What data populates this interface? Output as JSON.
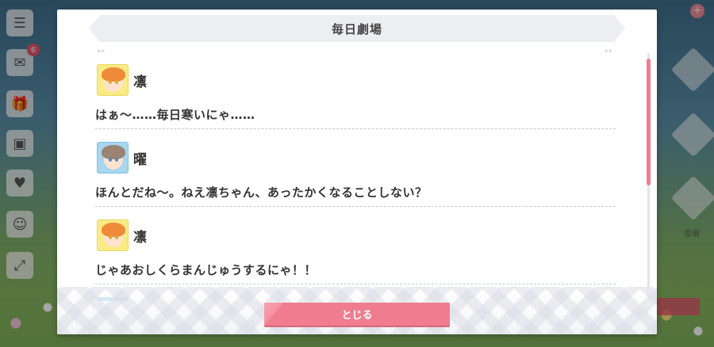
{
  "dialog": {
    "title": "毎日劇場",
    "close_label": "とじる",
    "entries": [
      {
        "speaker": "凛",
        "avatar": "rin",
        "line": "はぁ〜……毎日寒いにゃ……"
      },
      {
        "speaker": "曜",
        "avatar": "you",
        "line": "ほんとだね〜。ねえ凛ちゃん、あったかくなることしない？"
      },
      {
        "speaker": "凛",
        "avatar": "rin",
        "line": "じゃあおしくらまんじゅうするにゃ！！"
      }
    ]
  },
  "background": {
    "badges": {
      "inbox": "6"
    },
    "right_label": "合宿",
    "icons": [
      "menu-icon",
      "mail-icon",
      "present-icon",
      "gift-icon",
      "heart-icon",
      "member-icon",
      "expand-icon",
      "plus-icon"
    ]
  },
  "colors": {
    "accent": "#f07d8f",
    "title_bar": "#edeef2",
    "rin_avatar_bg": "#fbeb86",
    "you_avatar_bg": "#a7d6ee"
  }
}
